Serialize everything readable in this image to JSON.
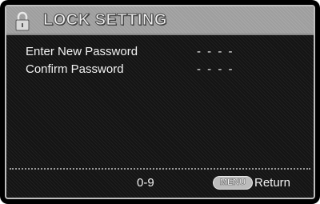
{
  "header": {
    "title": "LOCK SETTING",
    "icon": "padlock-icon"
  },
  "fields": [
    {
      "label": "Enter New Password",
      "value": "- - - -"
    },
    {
      "label": "Confirm Password",
      "value": "- - - -"
    }
  ],
  "footer": {
    "hint": "0-9",
    "menu_key": "MENU",
    "return_label": "Return"
  }
}
